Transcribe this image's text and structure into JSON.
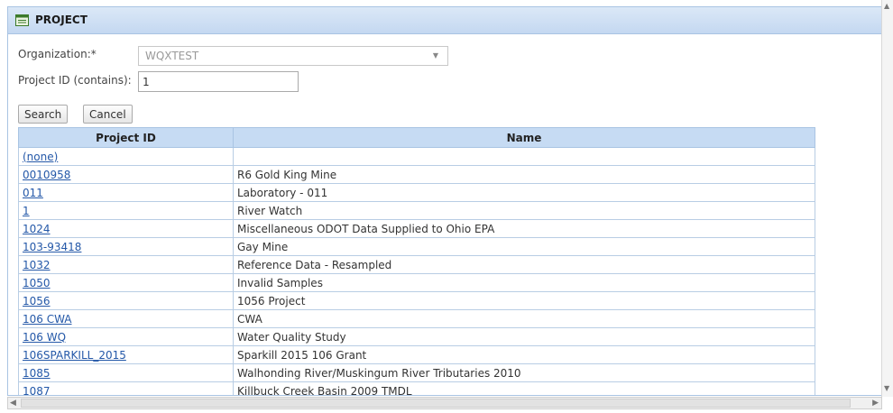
{
  "window": {
    "title": "PROJECT",
    "icon": "form-window-icon"
  },
  "form": {
    "organization_label": "Organization:*",
    "organization_value": "WQXTEST",
    "project_id_label": "Project ID (contains):",
    "project_id_value": "1"
  },
  "buttons": {
    "search": "Search",
    "cancel": "Cancel"
  },
  "grid": {
    "columns": [
      "Project ID",
      "Name"
    ],
    "rows": [
      {
        "id": "(none)",
        "name": ""
      },
      {
        "id": "0010958",
        "name": "R6 Gold King Mine"
      },
      {
        "id": "011",
        "name": "Laboratory - 011"
      },
      {
        "id": "1",
        "name": "River Watch"
      },
      {
        "id": "1024",
        "name": "Miscellaneous ODOT Data Supplied to Ohio EPA"
      },
      {
        "id": "103-93418",
        "name": "Gay Mine"
      },
      {
        "id": "1032",
        "name": "Reference Data - Resampled"
      },
      {
        "id": "1050",
        "name": "Invalid Samples"
      },
      {
        "id": "1056",
        "name": "1056 Project"
      },
      {
        "id": "106 CWA",
        "name": "CWA"
      },
      {
        "id": "106 WQ",
        "name": "Water Quality Study"
      },
      {
        "id": "106SPARKILL_2015",
        "name": "Sparkill 2015 106 Grant"
      },
      {
        "id": "1085",
        "name": "Walhonding River/Muskingum River Tributaries 2010"
      },
      {
        "id": "1087",
        "name": "Killbuck Creek Basin 2009 TMDL"
      }
    ]
  },
  "colors": {
    "header_bg": "#c6dbf3",
    "link": "#2458a8",
    "titlebar": "#c4d8f1"
  }
}
